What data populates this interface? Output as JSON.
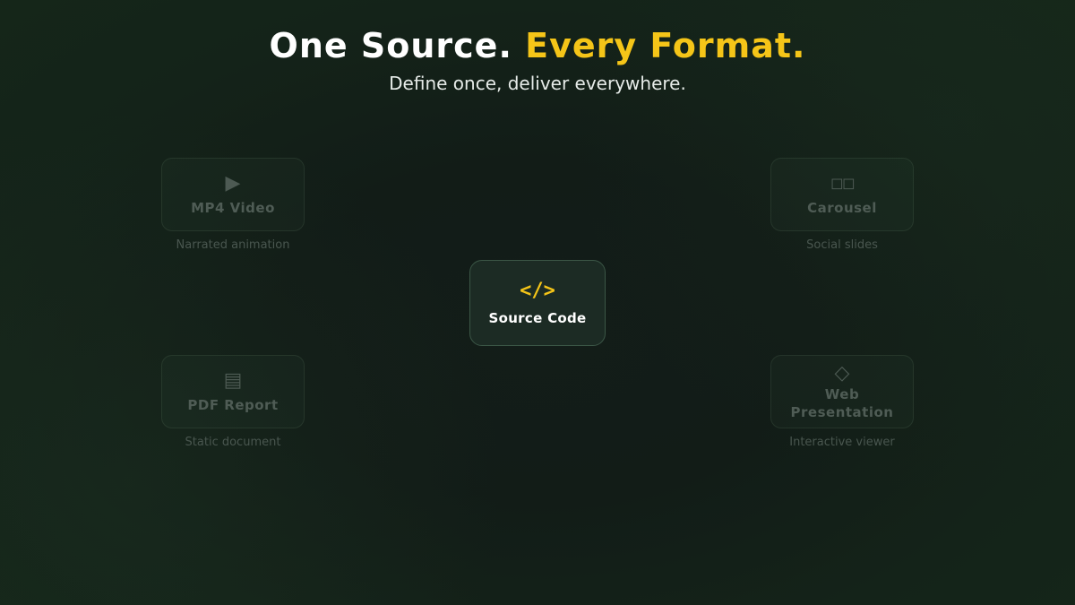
{
  "header": {
    "title_part1": "One Source.",
    "title_part2": "Every Format.",
    "subtitle": "Define once, deliver everywhere."
  },
  "center": {
    "icon": "</>",
    "label": "Source Code"
  },
  "outputs": [
    {
      "icon": "▶",
      "icon_name": "play-icon",
      "label": "MP4 Video",
      "caption": "Narrated animation"
    },
    {
      "icon": "◻◻",
      "icon_name": "slides-icon",
      "label": "Carousel",
      "caption": "Social slides"
    },
    {
      "icon": "▤",
      "icon_name": "document-icon",
      "label": "PDF Report",
      "caption": "Static document"
    },
    {
      "icon": "◇",
      "icon_name": "diamond-icon",
      "label": "Web Presentation",
      "caption": "Interactive viewer"
    }
  ],
  "colors": {
    "accent": "#f5c518",
    "background": "#121c17",
    "title": "#ffffff"
  }
}
